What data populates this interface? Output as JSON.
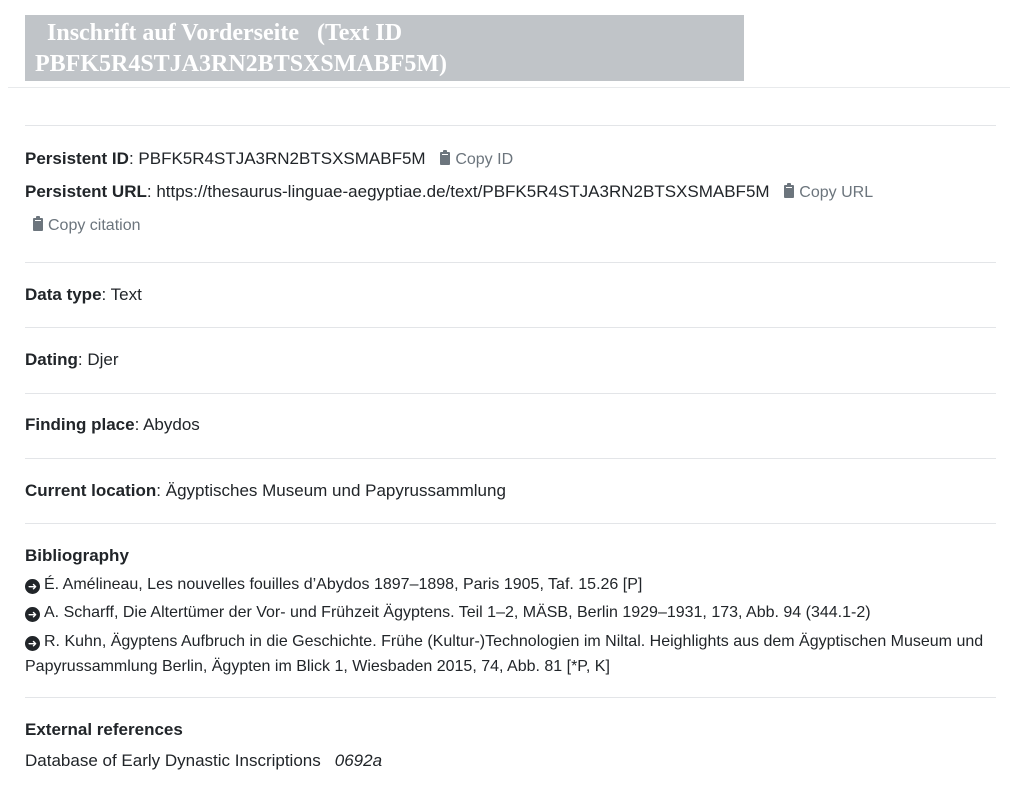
{
  "page": {
    "title_line1": "Inschrift auf Vorderseite",
    "title_line2_prefix": "(Text ID",
    "title_line3": "PBFK5R4STJA3RN2BTSXSMABF5M)"
  },
  "identifiers": {
    "persistent_id_label": "Persistent ID",
    "persistent_id_value": "PBFK5R4STJA3RN2BTSXSMABF5M",
    "copy_id_label": "Copy ID",
    "persistent_url_label": "Persistent URL",
    "persistent_url_value": "https://thesaurus-linguae-aegyptiae.de/text/PBFK5R4STJA3RN2BTSXSMABF5M",
    "copy_url_label": "Copy URL",
    "copy_citation_label": "Copy citation"
  },
  "fields": {
    "data_type_label": "Data type",
    "data_type_value": "Text",
    "dating_label": "Dating",
    "dating_value": "Djer",
    "finding_place_label": "Finding place",
    "finding_place_value": "Abydos",
    "current_location_label": "Current location",
    "current_location_value": "Ägyptisches Museum und Papyrussammlung"
  },
  "bibliography": {
    "heading": "Bibliography",
    "items": [
      "É. Amélineau, Les nouvelles fouilles d’Abydos 1897–1898, Paris 1905, Taf. 15.26 [P]",
      "A. Scharff, Die Altertümer der Vor- und Frühzeit Ägyptens. Teil 1–2, MÄSB, Berlin 1929–1931, 173, Abb. 94 (344.1-2)",
      "R. Kuhn, Ägyptens Aufbruch in die Geschichte. Frühe (Kultur-)Technologien im Niltal. Heighlights aus dem Ägyptischen Museum und Papyrussammlung Berlin, Ägypten im Blick 1, Wiesbaden 2015, 74, Abb. 81 [*P, K]"
    ]
  },
  "external_references": {
    "heading": "External references",
    "items": [
      {
        "source": "Database of Early Dynastic Inscriptions",
        "value": "0692a"
      }
    ]
  }
}
